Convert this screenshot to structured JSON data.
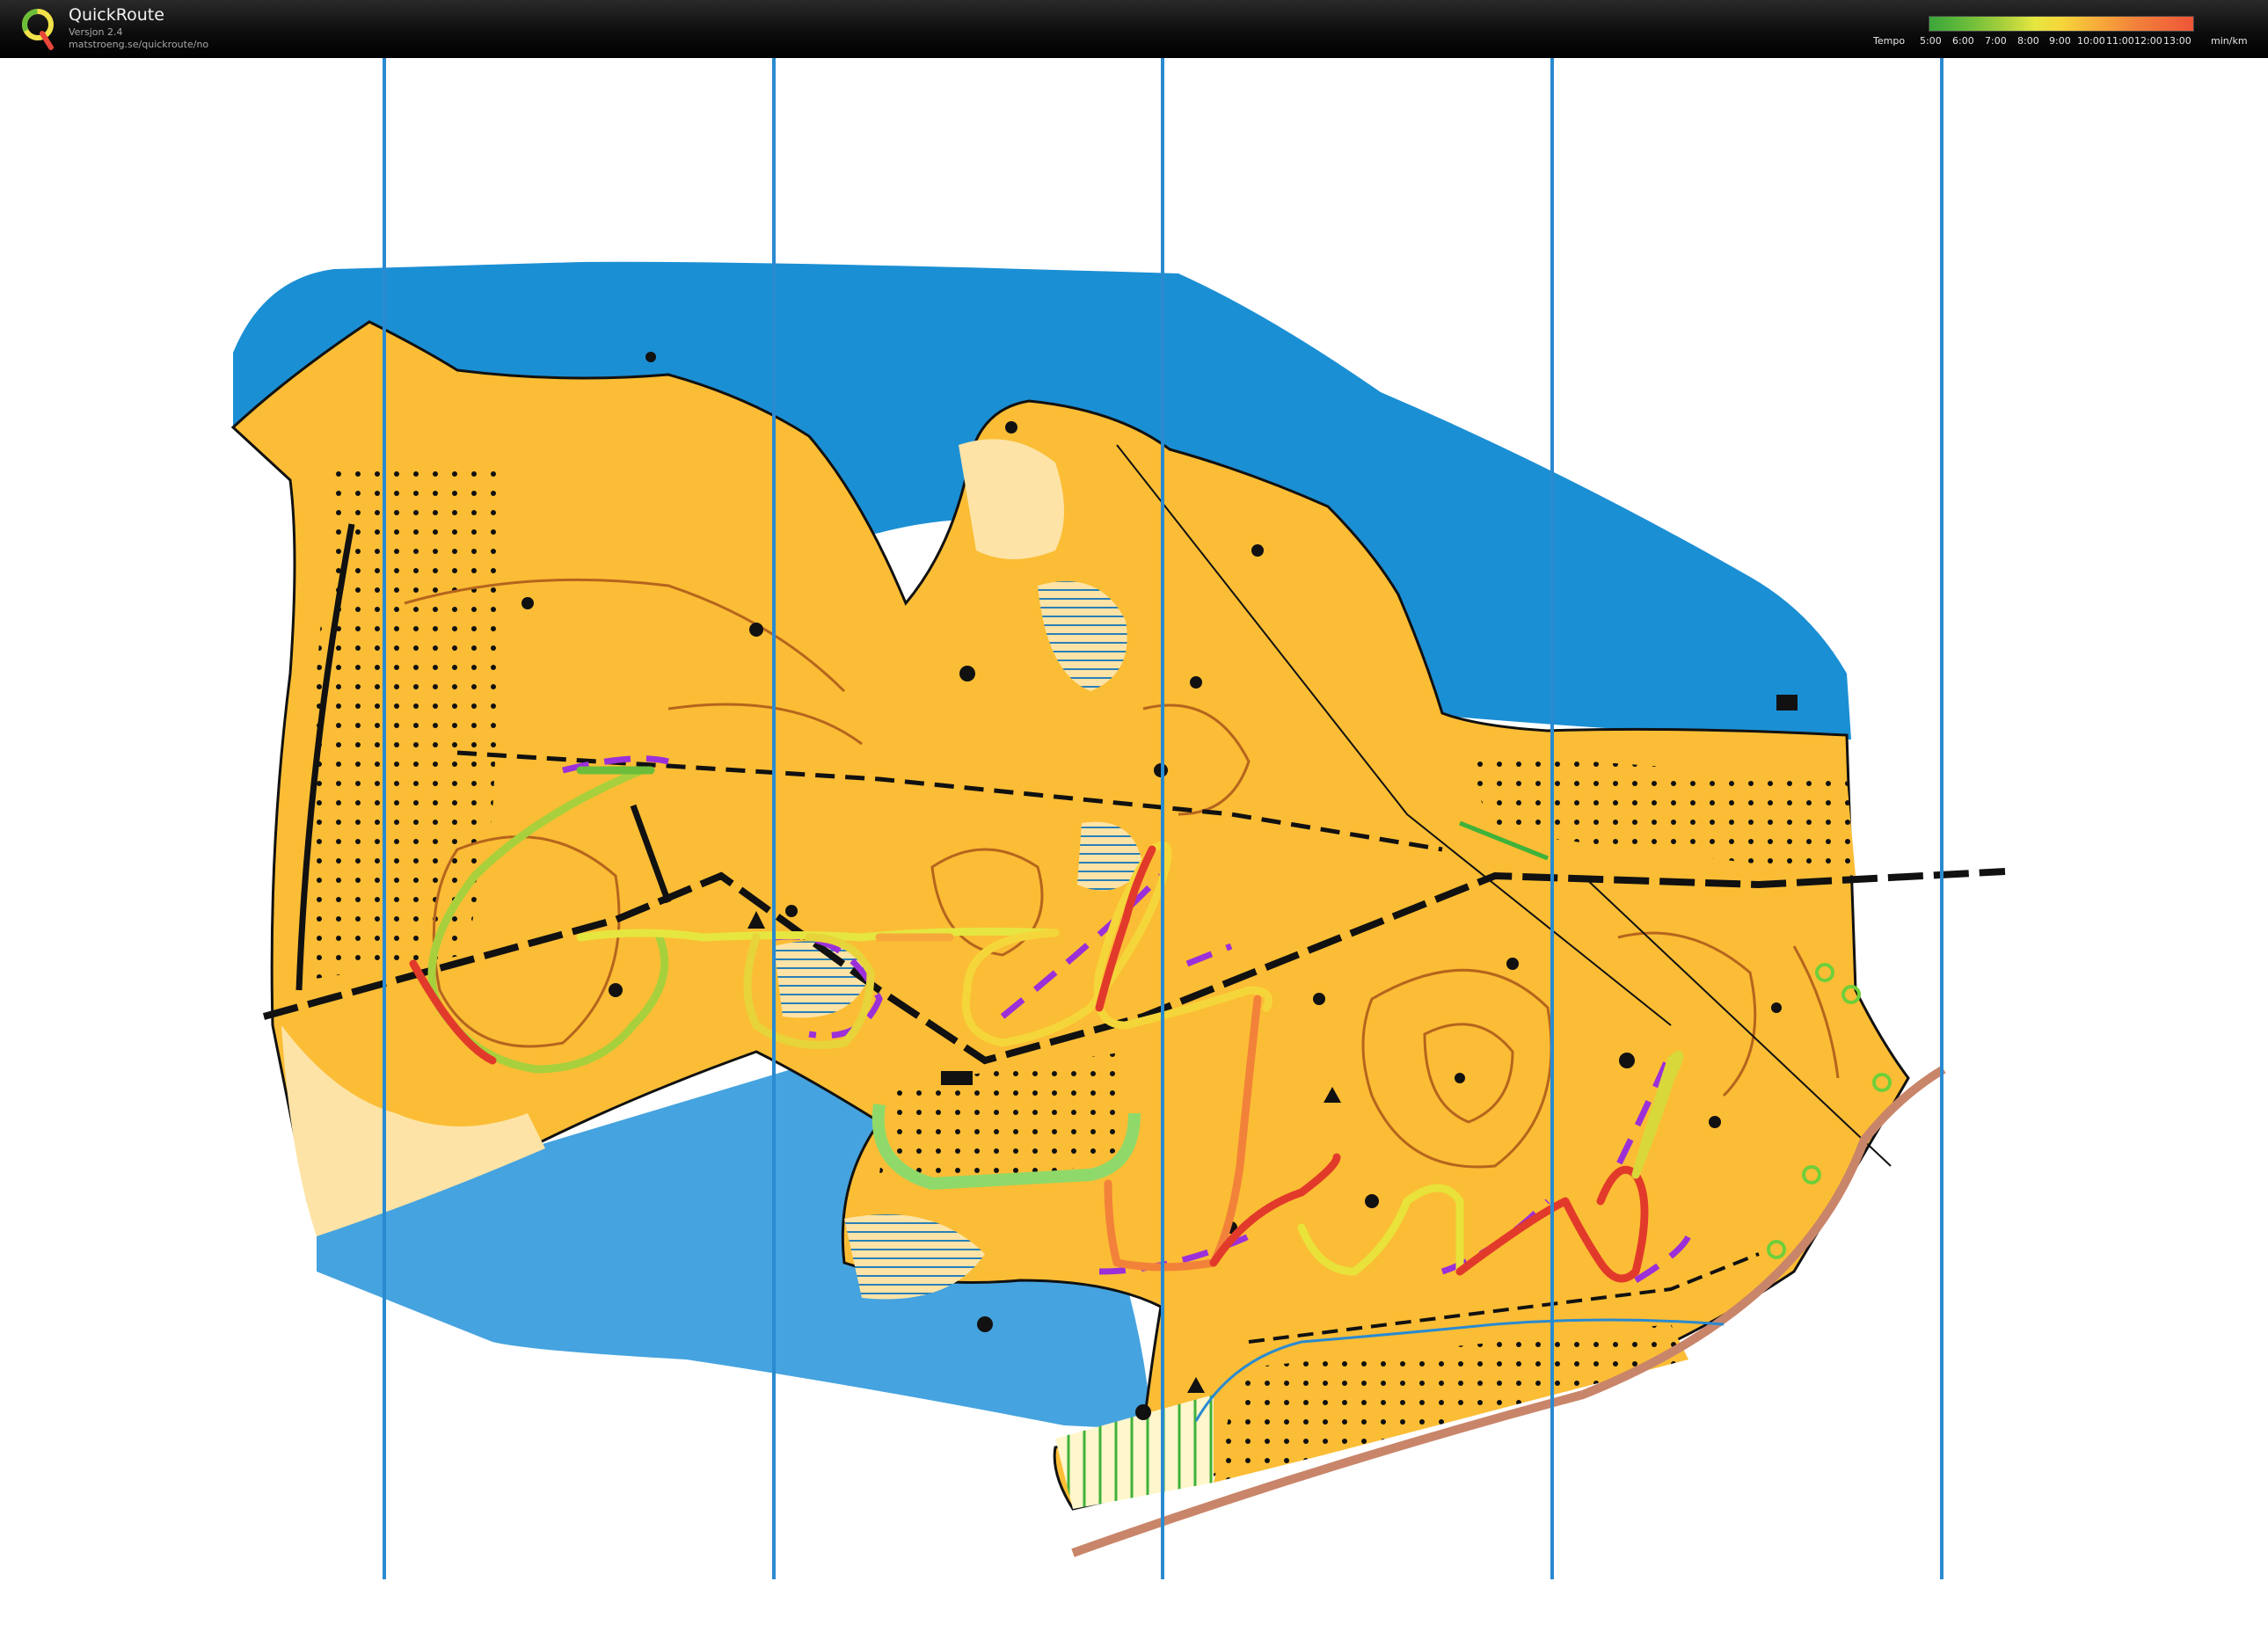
{
  "header": {
    "app_title": "QuickRoute",
    "version": "Versjon 2.4",
    "url": "matstroeng.se/quickroute/no"
  },
  "legend": {
    "label": "Tempo",
    "unit": "min/km",
    "ticks": [
      "5:00",
      "6:00",
      "7:00",
      "8:00",
      "9:00",
      "10:00",
      "11:00",
      "12:00",
      "13:00"
    ]
  },
  "colors": {
    "water": "#1b8fd4",
    "lake": "#45a3df",
    "forest_open": "#fbbd35",
    "rough_open": "#fde3a6",
    "contour": "#b5651d",
    "north_lines": "#2a8ad0",
    "route_fast": "#7cc43a",
    "route_medium": "#e8e23a",
    "route_slow": "#e23a2a",
    "route_planned": "#9b30d8"
  },
  "icons": {
    "logo": "quickroute-q-logo"
  }
}
